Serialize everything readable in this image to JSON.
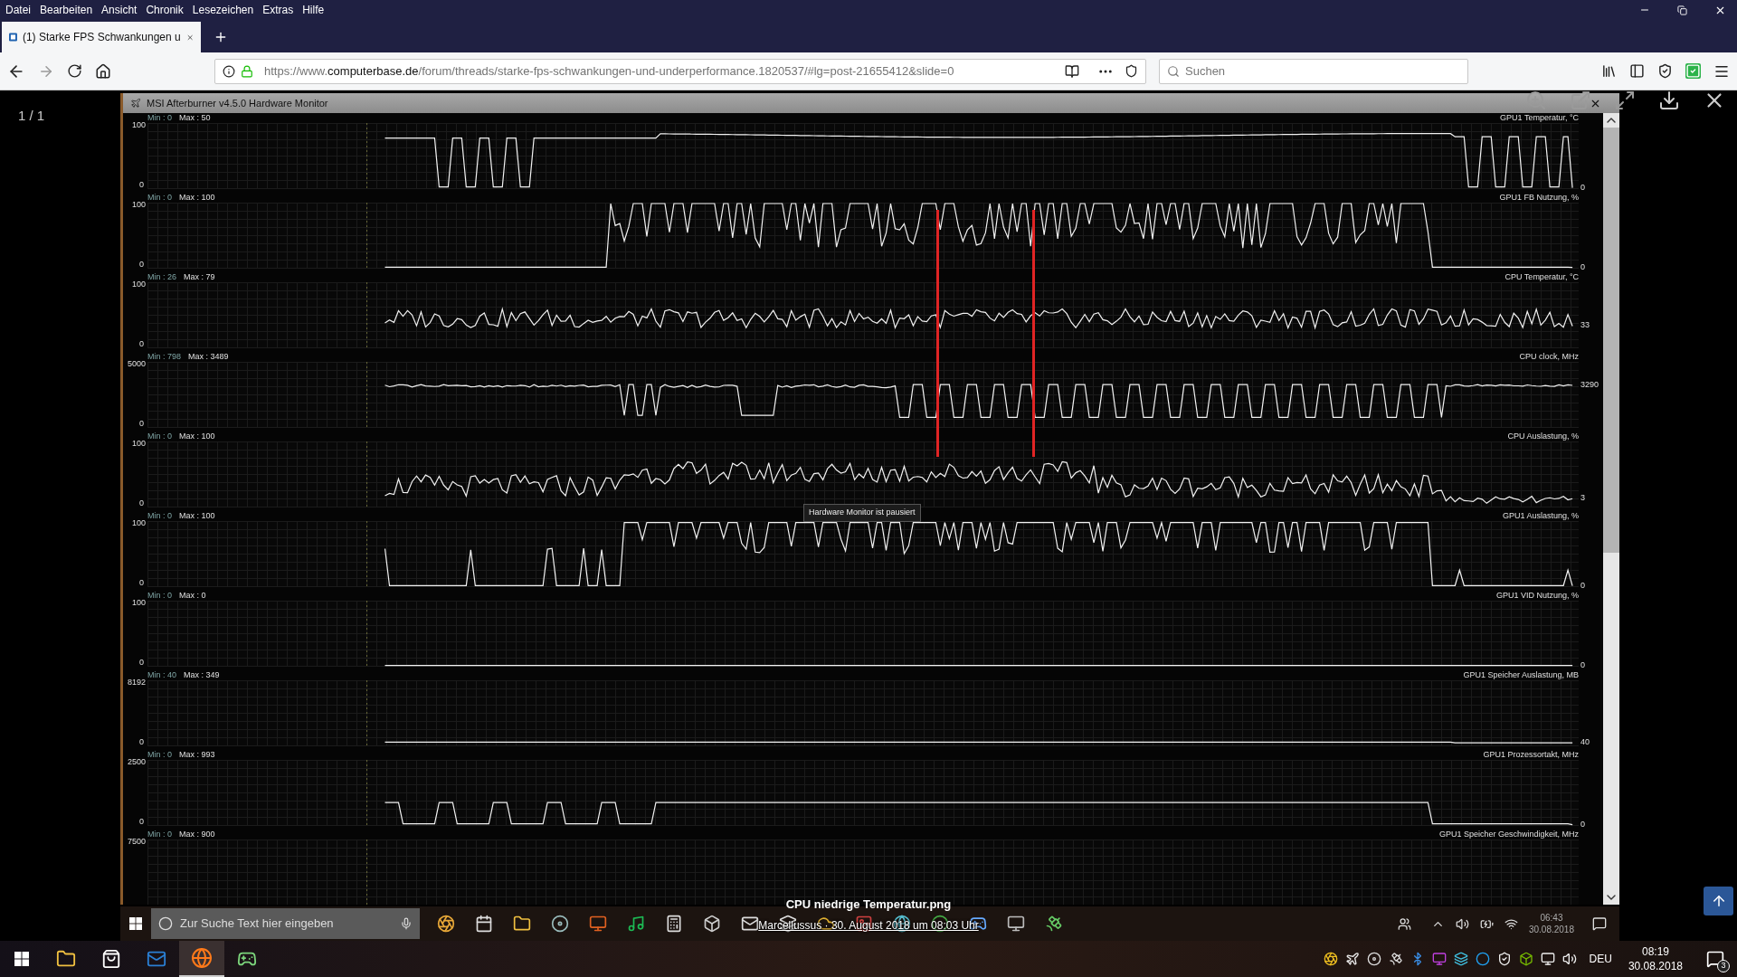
{
  "menu_bar": [
    "Datei",
    "Bearbeiten",
    "Ansicht",
    "Chronik",
    "Lesezeichen",
    "Extras",
    "Hilfe"
  ],
  "tabs": [
    {
      "title": "(1) Starke FPS Schwankungen u",
      "selected": true
    }
  ],
  "address_bar": {
    "scheme": "https://www.",
    "domain": "computerbase.de",
    "path": "/forum/threads/starke-fps-schwankungen-und-underperformance.1820537/#lg=post-21655412&slide=0"
  },
  "search": {
    "placeholder": "Suchen"
  },
  "viewer": {
    "counter": "1 / 1",
    "caption": "CPU niedrige Temperatur.png",
    "credit": "Marcellussus · 30. August 2018 um 08:03 Uhr"
  },
  "monitor": {
    "title": "MSI Afterburner v4.5.0 Hardware Monitor",
    "tooltip": "Hardware Monitor ist pausiert",
    "graphs": [
      {
        "min": "Min : 0",
        "max": "Max : 50",
        "name": "GPU1 Temperatur, °C",
        "top_tick": "100",
        "bottom_tick": "0",
        "current": "0"
      },
      {
        "min": "Min : 0",
        "max": "Max : 100",
        "name": "GPU1 FB Nutzung, %",
        "top_tick": "100",
        "bottom_tick": "0",
        "current": "0"
      },
      {
        "min": "Min : 26",
        "max": "Max : 79",
        "name": "CPU Temperatur, °C",
        "top_tick": "100",
        "bottom_tick": "0",
        "current": "33"
      },
      {
        "min": "Min : 798",
        "max": "Max : 3489",
        "name": "CPU clock, MHz",
        "top_tick": "5000",
        "bottom_tick": "0",
        "current": "3290"
      },
      {
        "min": "Min : 0",
        "max": "Max : 100",
        "name": "CPU Auslastung, %",
        "top_tick": "100",
        "bottom_tick": "0",
        "current": "3"
      },
      {
        "min": "Min : 0",
        "max": "Max : 100",
        "name": "GPU1 Auslastung, %",
        "top_tick": "100",
        "bottom_tick": "0",
        "current": "0"
      },
      {
        "min": "Min : 0",
        "max": "Max : 0",
        "name": "GPU1 VID Nutzung, %",
        "top_tick": "100",
        "bottom_tick": "0",
        "current": "0"
      },
      {
        "min": "Min : 40",
        "max": "Max : 349",
        "name": "GPU1 Speicher Auslastung, MB",
        "top_tick": "8192",
        "bottom_tick": "0",
        "current": "40"
      },
      {
        "min": "Min : 0",
        "max": "Max : 993",
        "name": "GPU1 Prozessortakt, MHz",
        "top_tick": "2500",
        "bottom_tick": "0",
        "current": "0"
      },
      {
        "min": "Min : 0",
        "max": "Max : 900",
        "name": "GPU1 Speicher Geschwindigkeit, MHz",
        "top_tick": "7500"
      }
    ]
  },
  "inner_taskbar": {
    "search_placeholder": "Zur Suche Text hier eingeben",
    "time": "06:43",
    "date": "30.08.2018"
  },
  "taskbar": {
    "language": "DEU",
    "time": "08:19",
    "date": "30.08.2018",
    "notifications": "3"
  }
}
